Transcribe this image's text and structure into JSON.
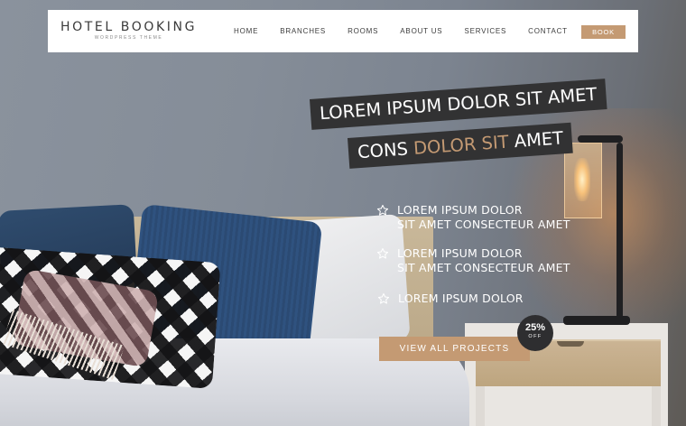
{
  "brand": {
    "title": "HOTEL BOOKING",
    "subtitle": "WORDPRESS THEME"
  },
  "nav": {
    "items": [
      {
        "label": "HOME"
      },
      {
        "label": "BRANCHES"
      },
      {
        "label": "ROOMS"
      },
      {
        "label": "ABOUT US"
      },
      {
        "label": "SERVICES"
      },
      {
        "label": "CONTACT"
      }
    ],
    "book_label": "BOOK"
  },
  "hero": {
    "line1": "LOREM IPSUM DOLOR SIT AMET",
    "line2_prefix": "CONS ",
    "line2_accent": "DOLOR SIT",
    "line2_suffix": " AMET",
    "features": [
      {
        "line1": "LOREM IPSUM DOLOR",
        "line2": "SIT AMET CONSECTEUR AMET",
        "icon": "star-outline-icon"
      },
      {
        "line1": "LOREM IPSUM DOLOR",
        "line2": "SIT AMET CONSECTEUR AMET",
        "icon": "star-outline-icon"
      },
      {
        "line1": "LOREM IPSUM DOLOR",
        "line2": "",
        "icon": "star-outline-icon"
      }
    ],
    "cta_label": "VIEW ALL PROJECTS",
    "offer": {
      "value": "25%",
      "label": "OFF"
    }
  },
  "colors": {
    "accent": "#c49a73",
    "banner_bg": "#323233",
    "header_bg": "#ffffff"
  }
}
